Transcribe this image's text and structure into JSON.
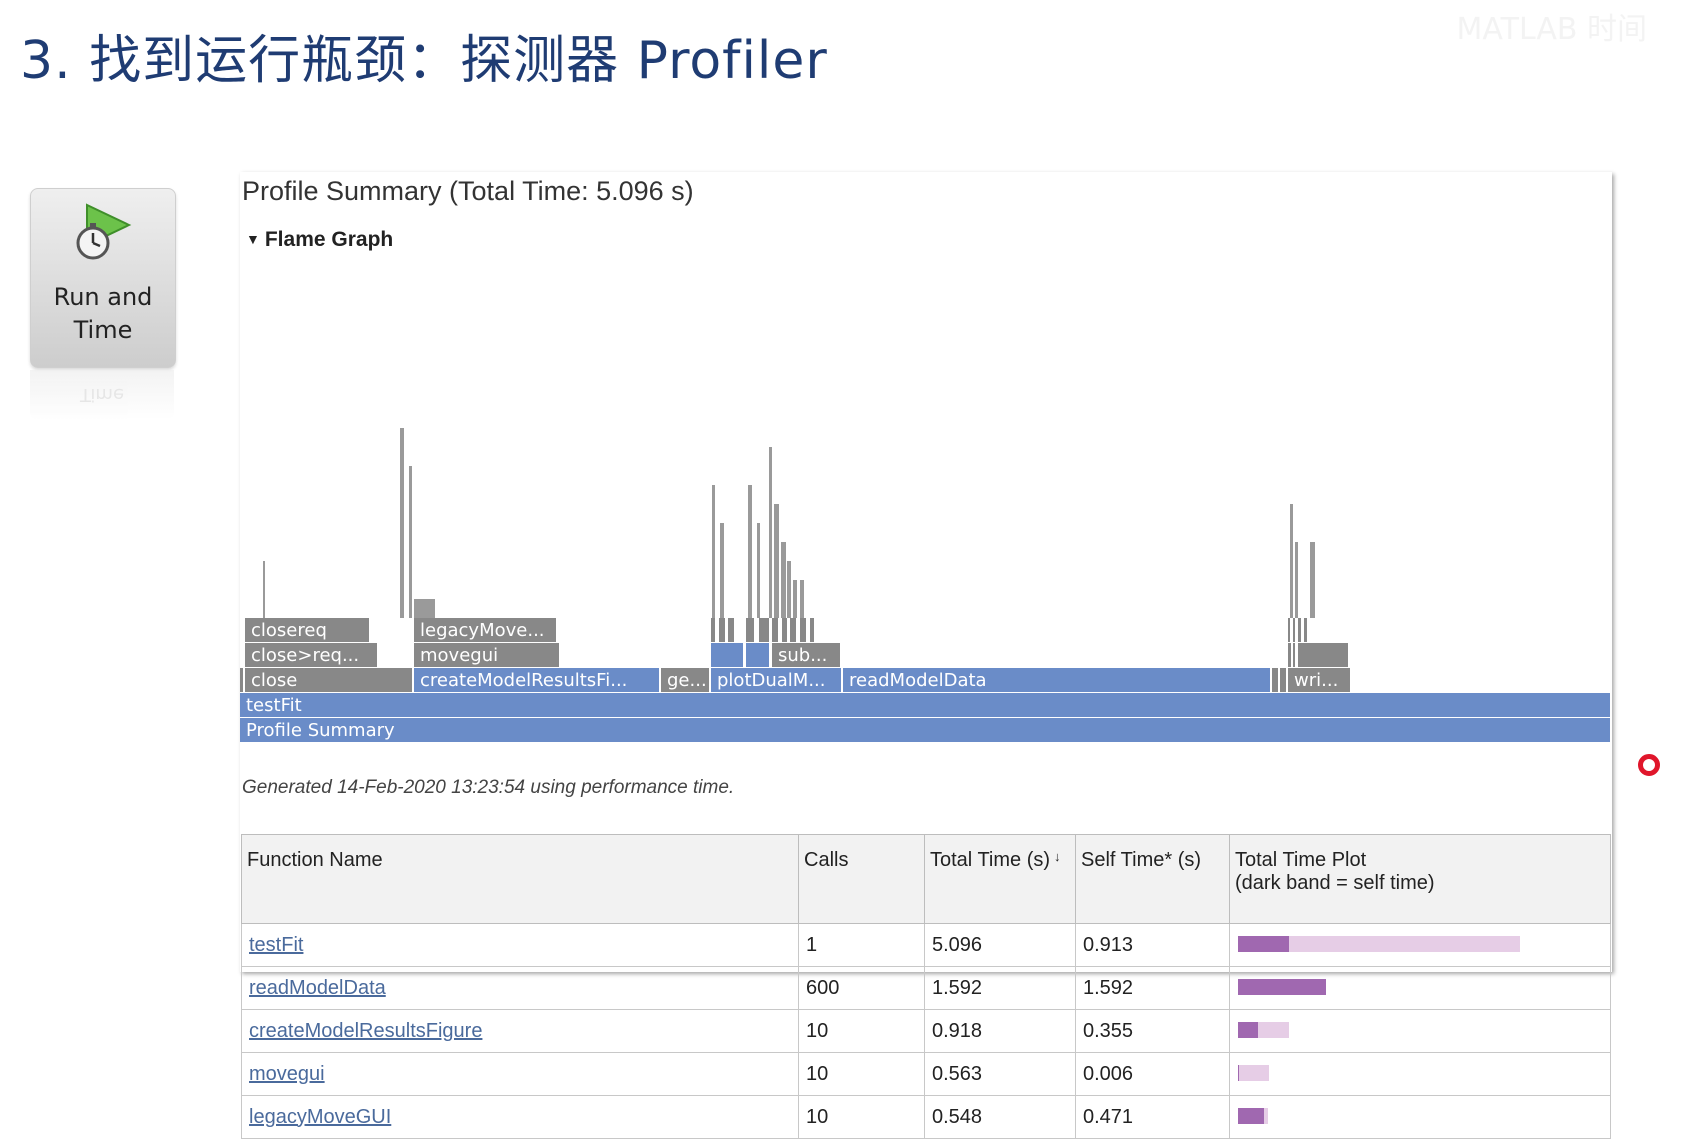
{
  "slide": {
    "title": "3. 找到运行瓶颈：探测器 Profiler",
    "watermark": "MATLAB 时间"
  },
  "run_button": {
    "label_line1": "Run and",
    "label_line2": "Time",
    "reflection": "Time"
  },
  "report": {
    "title": "Profile Summary (Total Time: 5.096 s)",
    "flame_section_label": "Flame Graph",
    "generated_text": "Generated 14-Feb-2020 13:23:54 using performance time."
  },
  "flame_graph": {
    "colors": {
      "blue": "#6a8cc8",
      "gray": "#888888",
      "gray_light": "#9a9a9a"
    },
    "rows": [
      {
        "level": 0,
        "blocks": [
          {
            "label": "Profile Summary",
            "start": 0.0,
            "width": 1.0,
            "color": "blue"
          }
        ]
      },
      {
        "level": 1,
        "blocks": [
          {
            "label": "testFit",
            "start": 0.0,
            "width": 1.0,
            "color": "blue"
          }
        ]
      },
      {
        "level": 2,
        "blocks": [
          {
            "label": "",
            "start": 0.0,
            "width": 0.0035,
            "color": "gray"
          },
          {
            "label": "close",
            "start": 0.0035,
            "width": 0.123,
            "color": "gray"
          },
          {
            "label": "createModelResultsFi...",
            "start": 0.1265,
            "width": 0.18,
            "color": "blue"
          },
          {
            "label": "ge...",
            "start": 0.3065,
            "width": 0.0365,
            "color": "gray"
          },
          {
            "label": "plotDualM...",
            "start": 0.343,
            "width": 0.0965,
            "color": "blue"
          },
          {
            "label": "readModelData",
            "start": 0.4395,
            "width": 0.3125,
            "color": "blue"
          },
          {
            "label": "",
            "start": 0.752,
            "width": 0.006,
            "color": "gray"
          },
          {
            "label": "",
            "start": 0.758,
            "width": 0.0056,
            "color": "gray"
          },
          {
            "label": "wri...",
            "start": 0.7636,
            "width": 0.0463,
            "color": "gray"
          }
        ]
      },
      {
        "level": 3,
        "blocks": [
          {
            "label": "close>req...",
            "start": 0.0035,
            "width": 0.098,
            "color": "gray"
          },
          {
            "label": "movegui",
            "start": 0.1265,
            "width": 0.107,
            "color": "gray"
          },
          {
            "label": "",
            "start": 0.343,
            "width": 0.025,
            "color": "blue"
          },
          {
            "label": "",
            "start": 0.369,
            "width": 0.018,
            "color": "blue"
          },
          {
            "label": "sub...",
            "start": 0.388,
            "width": 0.051,
            "color": "gray"
          },
          {
            "label": "",
            "start": 0.7636,
            "width": 0.0038,
            "color": "gray"
          },
          {
            "label": "",
            "start": 0.7678,
            "width": 0.0025,
            "color": "gray"
          },
          {
            "label": "",
            "start": 0.771,
            "width": 0.038,
            "color": "gray"
          }
        ]
      },
      {
        "level": 4,
        "blocks": [
          {
            "label": "closereq",
            "start": 0.0035,
            "width": 0.092,
            "color": "gray"
          },
          {
            "label": "legacyMove...",
            "start": 0.1265,
            "width": 0.105,
            "color": "gray"
          },
          {
            "label": "",
            "start": 0.343,
            "width": 0.0045,
            "color": "gray"
          },
          {
            "label": "",
            "start": 0.349,
            "width": 0.006,
            "color": "gray"
          },
          {
            "label": "",
            "start": 0.356,
            "width": 0.006,
            "color": "gray"
          },
          {
            "label": "",
            "start": 0.369,
            "width": 0.007,
            "color": "gray"
          },
          {
            "label": "",
            "start": 0.3785,
            "width": 0.0085,
            "color": "gray"
          },
          {
            "label": "",
            "start": 0.388,
            "width": 0.006,
            "color": "gray"
          },
          {
            "label": "",
            "start": 0.395,
            "width": 0.005,
            "color": "gray"
          },
          {
            "label": "",
            "start": 0.401,
            "width": 0.0055,
            "color": "gray"
          },
          {
            "label": "",
            "start": 0.408,
            "width": 0.006,
            "color": "gray"
          },
          {
            "label": "",
            "start": 0.4155,
            "width": 0.0045,
            "color": "gray"
          },
          {
            "label": "",
            "start": 0.764,
            "width": 0.0025,
            "color": "gray"
          },
          {
            "label": "",
            "start": 0.7678,
            "width": 0.0025,
            "color": "gray"
          },
          {
            "label": "",
            "start": 0.7715,
            "width": 0.0035,
            "color": "gray"
          },
          {
            "label": "",
            "start": 0.7755,
            "width": 0.0035,
            "color": "gray"
          }
        ]
      }
    ],
    "spikes": [
      {
        "start": 0.0165,
        "width": 0.0015,
        "depth": 3
      },
      {
        "start": 0.1165,
        "width": 0.003,
        "depth": 10
      },
      {
        "start": 0.1235,
        "width": 0.0025,
        "depth": 8
      },
      {
        "start": 0.1265,
        "width": 0.015,
        "depth": 1
      },
      {
        "start": 0.344,
        "width": 0.0025,
        "depth": 7
      },
      {
        "start": 0.35,
        "width": 0.003,
        "depth": 5
      },
      {
        "start": 0.37,
        "width": 0.003,
        "depth": 7
      },
      {
        "start": 0.3765,
        "width": 0.0025,
        "depth": 5
      },
      {
        "start": 0.3855,
        "width": 0.002,
        "depth": 9
      },
      {
        "start": 0.389,
        "width": 0.004,
        "depth": 6
      },
      {
        "start": 0.394,
        "width": 0.004,
        "depth": 4
      },
      {
        "start": 0.399,
        "width": 0.003,
        "depth": 3
      },
      {
        "start": 0.403,
        "width": 0.003,
        "depth": 2
      },
      {
        "start": 0.408,
        "width": 0.003,
        "depth": 2
      },
      {
        "start": 0.765,
        "width": 0.002,
        "depth": 6
      },
      {
        "start": 0.769,
        "width": 0.002,
        "depth": 4
      },
      {
        "start": 0.78,
        "width": 0.004,
        "depth": 4
      },
      {
        "start": 0.781,
        "width": 0.002,
        "depth": 2
      }
    ]
  },
  "table": {
    "headers": {
      "function_name": "Function Name",
      "calls": "Calls",
      "total_time": "Total Time (s)",
      "sort_indicator": "↓",
      "self_time": "Self Time* (s)",
      "plot_line1": "Total Time Plot",
      "plot_line2": "(dark band = self time)"
    },
    "rows": [
      {
        "name": "testFit",
        "calls": "1",
        "total": "5.096",
        "self": "0.913",
        "total_val": 5.096,
        "self_val": 0.913
      },
      {
        "name": "readModelData",
        "calls": "600",
        "total": "1.592",
        "self": "1.592",
        "total_val": 1.592,
        "self_val": 1.592
      },
      {
        "name": "createModelResultsFigure",
        "calls": "10",
        "total": "0.918",
        "self": "0.355",
        "total_val": 0.918,
        "self_val": 0.355
      },
      {
        "name": "movegui",
        "calls": "10",
        "total": "0.563",
        "self": "0.006",
        "total_val": 0.563,
        "self_val": 0.006
      },
      {
        "name": "legacyMoveGUI",
        "calls": "10",
        "total": "0.548",
        "self": "0.471",
        "total_val": 0.548,
        "self_val": 0.471
      }
    ],
    "plot_colors": {
      "total": "#e6cde6",
      "self": "#a068b0"
    }
  }
}
